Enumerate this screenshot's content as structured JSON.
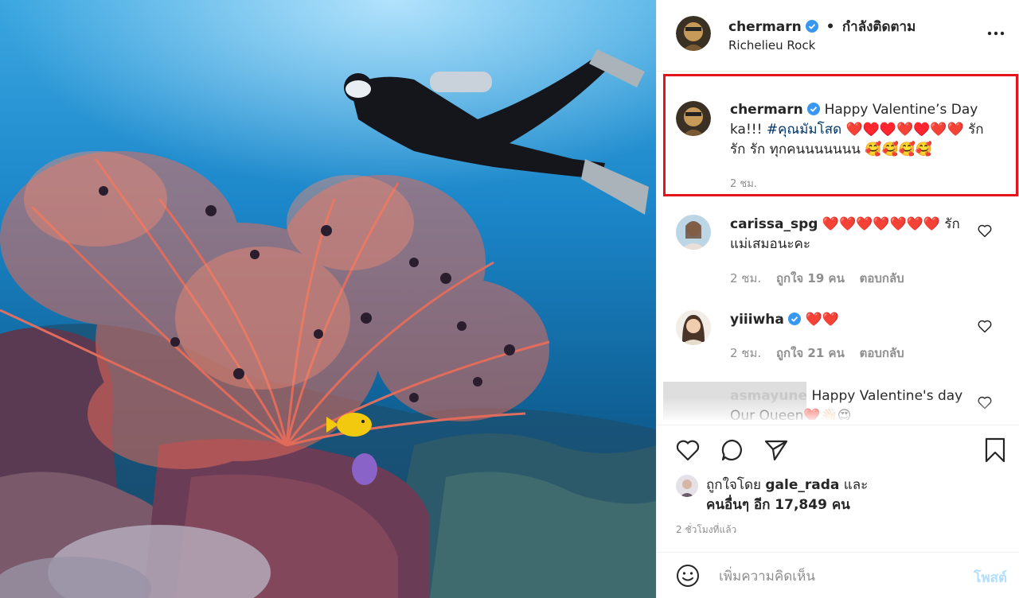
{
  "photo": {
    "alt_icon": "underwater-photo"
  },
  "header": {
    "username": "chermarn",
    "dot": "•",
    "follow_status": "กำลังติดตาม",
    "location": "Richelieu Rock",
    "more_icon": "more-horizontal-icon"
  },
  "caption": {
    "username": "chermarn",
    "text_part1": "Happy Valentine’s Day ka!!! ",
    "hashtag": "#คุณมัมโสด",
    "text_part2": " ❤️♥️♥️❤️♥️❤️❤️ รัก รัก รัก ทุกคนนนนนนน 🥰🥰🥰🥰",
    "time": "2 ชม."
  },
  "comments": [
    {
      "username": "carissa_spg",
      "text": "❤️❤️❤️❤️❤️❤️❤️ รักแม่เสมอนะคะ",
      "time": "2 ชม.",
      "likes": "ถูกใจ 19 คน",
      "reply": "ตอบกลับ",
      "verified": false
    },
    {
      "username": "yiiiwha",
      "text": "❤️❤️",
      "time": "2 ชม.",
      "likes": "ถูกใจ 21 คน",
      "reply": "ตอบกลับ",
      "verified": true
    },
    {
      "username": "asmayune",
      "text": "Happy Valentine's day Our Queen❤️👋🏻😍"
    }
  ],
  "actions": {
    "liked_by_prefix": "ถูกใจโดย ",
    "liked_by_user": "gale_rada",
    "liked_by_suffix": " และ",
    "others_count": "คนอื่นๆ อีก 17,849 คน",
    "post_time": "2 ชั่วโมงที่แล้ว"
  },
  "add_comment": {
    "placeholder": "เพิ่มความคิดเห็น",
    "post_label": "โพสต์"
  },
  "colors": {
    "highlight_border": "#e4141c",
    "verified_blue": "#3897f0",
    "hashtag": "#00376b",
    "muted": "#8e8e8e",
    "post_button": "#b2dffc"
  }
}
